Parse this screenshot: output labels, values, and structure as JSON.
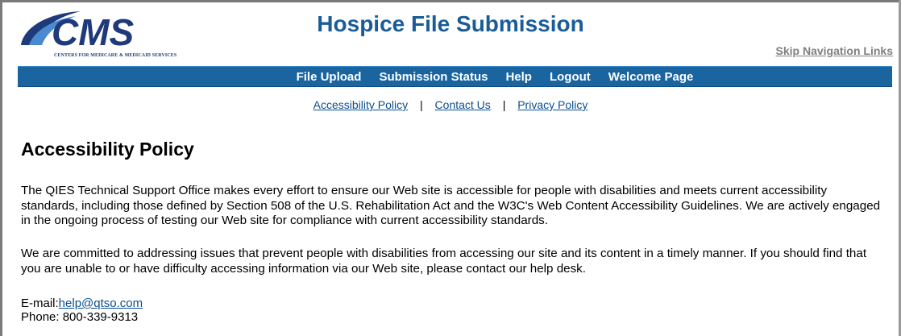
{
  "header": {
    "logo_text": "CMS",
    "logo_tagline": "CENTERS FOR MEDICARE & MEDICAID SERVICES",
    "title": "Hospice File Submission",
    "skip_link": "Skip Navigation Links",
    "colors": {
      "title": "#1a5c99",
      "navbar": "#1a64a0",
      "logo": "#1f3a7a"
    }
  },
  "nav": {
    "items": [
      "File Upload",
      "Submission Status",
      "Help",
      "Logout",
      "Welcome Page"
    ]
  },
  "subnav": {
    "links": [
      "Accessibility Policy",
      "Contact Us",
      "Privacy Policy"
    ],
    "separator": "|"
  },
  "main": {
    "heading": "Accessibility Policy",
    "paragraphs": [
      "The QIES Technical Support Office makes every effort to ensure our Web site is accessible for people with disabilities and meets current accessibility standards, including those defined by Section 508 of the U.S. Rehabilitation Act and the W3C's Web Content Accessibility Guidelines. We are actively engaged in the ongoing process of testing our Web site for compliance with current accessibility standards.",
      "We are committed to addressing issues that prevent people with disabilities from accessing our site and its content in a timely manner. If you should find that you are unable to or have difficulty accessing information via our Web site, please contact our help desk."
    ],
    "contact": {
      "email_label": "E-mail:",
      "email": "help@qtso.com",
      "phone": "Phone: 800-339-9313"
    }
  }
}
